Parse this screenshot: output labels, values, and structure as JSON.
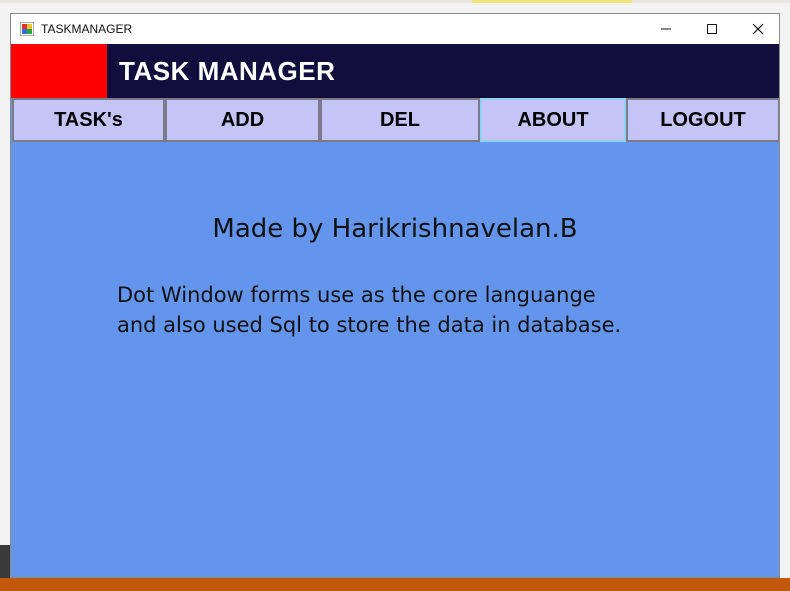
{
  "window": {
    "title": "TASKMANAGER"
  },
  "header": {
    "title": "TASK MANAGER"
  },
  "nav": {
    "tasks_label": "TASK's",
    "add_label": "ADD",
    "del_label": "DEL",
    "about_label": "ABOUT",
    "logout_label": "LOGOUT"
  },
  "about": {
    "made_by": "Made by Harikrishnavelan.B",
    "line1": "Dot Window forms use as the core languange",
    "line2": "and also used Sql to store the data in database."
  },
  "colors": {
    "header_bg": "#120d3c",
    "header_accent": "#ff0000",
    "nav_button_bg": "#c4c4f6",
    "content_bg": "#6495ed"
  }
}
